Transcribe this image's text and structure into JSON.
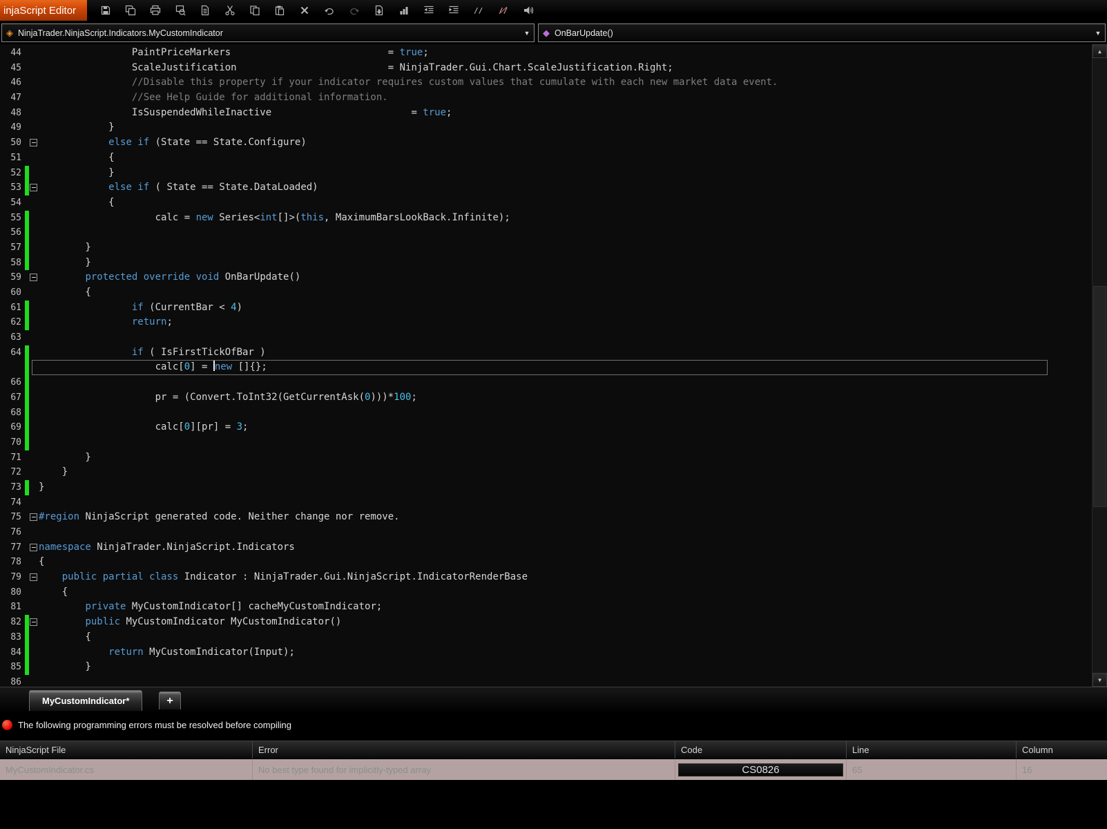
{
  "window": {
    "title": "injaScript Editor"
  },
  "colors": {
    "kw": "#569cd6",
    "cm": "#7e7e7e",
    "num": "#48c0e8",
    "txt": "#d6d6d6",
    "chg": "#1ddd1d",
    "titleTop": "#e8661c",
    "titleBot": "#9d3304",
    "rowBg": "#b4a2a2",
    "red": "#d80b00"
  },
  "toolbar": {
    "icons": [
      "save-icon",
      "save-all-icon",
      "print-icon",
      "print-preview-icon",
      "document-icon",
      "scissors-icon",
      "copy-icon",
      "paste-icon",
      "delete-x-icon",
      "undo-arrow-icon",
      "redo-arrow-icon",
      "snippet-icon",
      "chart-bars-icon",
      "outdent-icon",
      "indent-icon",
      "comment-icon",
      "uncomment-icon",
      "compile-speaker-icon"
    ]
  },
  "navigation": {
    "type_selector": "NinjaTrader.NinjaScript.Indicators.MyCustomIndicator",
    "member_selector": "OnBarUpdate()"
  },
  "tabs": {
    "active": "MyCustomIndicator*",
    "new_tab": "+"
  },
  "editor": {
    "lines": [
      {
        "n": "44",
        "seg": [
          [
            "                PaintPriceMarkers                           = ",
            "d"
          ],
          [
            "true",
            "k"
          ],
          [
            ";",
            "d"
          ]
        ]
      },
      {
        "n": "45",
        "seg": [
          [
            "                ScaleJustification                          = NinjaTrader.Gui.Chart.ScaleJustification.Right;",
            "d"
          ]
        ]
      },
      {
        "n": "46",
        "seg": [
          [
            "                //Disable this property if your indicator requires custom values that cumulate with each new market data event.",
            "c"
          ]
        ]
      },
      {
        "n": "47",
        "seg": [
          [
            "                //See Help Guide for additional information.",
            "c"
          ]
        ]
      },
      {
        "n": "48",
        "seg": [
          [
            "                IsSuspendedWhileInactive                        = ",
            "d"
          ],
          [
            "true",
            "k"
          ],
          [
            ";",
            "d"
          ]
        ]
      },
      {
        "n": "49",
        "seg": [
          [
            "            }",
            "d"
          ]
        ]
      },
      {
        "n": "50",
        "fold": true,
        "seg": [
          [
            "            ",
            "d"
          ],
          [
            "else if",
            "k"
          ],
          [
            " (State == State.Configure)",
            "d"
          ]
        ]
      },
      {
        "n": "51",
        "seg": [
          [
            "            {",
            "d"
          ]
        ]
      },
      {
        "n": "52",
        "green": true,
        "seg": [
          [
            "            }",
            "d"
          ]
        ]
      },
      {
        "n": "53",
        "fold": true,
        "green": true,
        "seg": [
          [
            "            ",
            "d"
          ],
          [
            "else if",
            "k"
          ],
          [
            " ( State == State.DataLoaded)",
            "d"
          ]
        ]
      },
      {
        "n": "54",
        "seg": [
          [
            "            {",
            "d"
          ]
        ]
      },
      {
        "n": "55",
        "green": true,
        "seg": [
          [
            "                    calc = ",
            "d"
          ],
          [
            "new",
            "k"
          ],
          [
            " Series<",
            "d"
          ],
          [
            "int",
            "k"
          ],
          [
            "[]>(",
            "d"
          ],
          [
            "this",
            "k"
          ],
          [
            ", MaximumBarsLookBack.Infinite);",
            "d"
          ]
        ]
      },
      {
        "n": "56",
        "green": true,
        "seg": []
      },
      {
        "n": "57",
        "green": true,
        "seg": [
          [
            "        }",
            "d"
          ]
        ]
      },
      {
        "n": "58",
        "green": true,
        "seg": [
          [
            "        }",
            "d"
          ]
        ]
      },
      {
        "n": "59",
        "fold": true,
        "seg": [
          [
            "        ",
            "d"
          ],
          [
            "protected override void",
            "k"
          ],
          [
            " OnBarUpdate()",
            "d"
          ]
        ]
      },
      {
        "n": "60",
        "seg": [
          [
            "        {",
            "d"
          ]
        ]
      },
      {
        "n": "61",
        "green": true,
        "seg": [
          [
            "                ",
            "d"
          ],
          [
            "if",
            "k"
          ],
          [
            " (CurrentBar < ",
            "d"
          ],
          [
            "4",
            "n"
          ],
          [
            ")",
            "d"
          ]
        ]
      },
      {
        "n": "62",
        "green": true,
        "seg": [
          [
            "                ",
            "d"
          ],
          [
            "return",
            "k"
          ],
          [
            ";",
            "d"
          ]
        ]
      },
      {
        "n": "63",
        "seg": []
      },
      {
        "n": "64",
        "green": true,
        "seg": [
          [
            "                ",
            "d"
          ],
          [
            "if",
            "k"
          ],
          [
            " ( IsFirstTickOfBar )",
            "d"
          ]
        ]
      },
      {
        "n": "",
        "sel": true,
        "green": true,
        "seg": [
          [
            "                    calc[",
            "d"
          ],
          [
            "0",
            "n"
          ],
          [
            "] = ",
            "d"
          ],
          [
            "",
            "caret"
          ],
          [
            "new",
            "k"
          ],
          [
            " []{};",
            "d"
          ]
        ]
      },
      {
        "n": "66",
        "green": true,
        "seg": []
      },
      {
        "n": "67",
        "green": true,
        "seg": [
          [
            "                    pr = (Convert.ToInt32(GetCurrentAsk(",
            "d"
          ],
          [
            "0",
            "n"
          ],
          [
            ")))*",
            "d"
          ],
          [
            "100",
            "n"
          ],
          [
            ";",
            "d"
          ]
        ]
      },
      {
        "n": "68",
        "green": true,
        "seg": []
      },
      {
        "n": "69",
        "green": true,
        "seg": [
          [
            "                    calc[",
            "d"
          ],
          [
            "0",
            "n"
          ],
          [
            "][pr] = ",
            "d"
          ],
          [
            "3",
            "n"
          ],
          [
            ";",
            "d"
          ]
        ]
      },
      {
        "n": "70",
        "green": true,
        "seg": []
      },
      {
        "n": "71",
        "seg": [
          [
            "        }",
            "d"
          ]
        ]
      },
      {
        "n": "72",
        "seg": [
          [
            "    }",
            "d"
          ]
        ]
      },
      {
        "n": "73",
        "green": true,
        "seg": [
          [
            "}",
            "d"
          ]
        ]
      },
      {
        "n": "74",
        "seg": []
      },
      {
        "n": "75",
        "fold": true,
        "seg": [
          [
            "#region",
            "k"
          ],
          [
            " NinjaScript generated code. Neither change nor remove.",
            "d"
          ]
        ]
      },
      {
        "n": "76",
        "seg": []
      },
      {
        "n": "77",
        "fold": true,
        "seg": [
          [
            "namespace",
            "k"
          ],
          [
            " NinjaTrader.NinjaScript.Indicators",
            "d"
          ]
        ]
      },
      {
        "n": "78",
        "seg": [
          [
            "{",
            "d"
          ]
        ]
      },
      {
        "n": "79",
        "fold": true,
        "seg": [
          [
            "    ",
            "d"
          ],
          [
            "public partial class",
            "k"
          ],
          [
            " Indicator : NinjaTrader.Gui.NinjaScript.IndicatorRenderBase",
            "d"
          ]
        ]
      },
      {
        "n": "80",
        "seg": [
          [
            "    {",
            "d"
          ]
        ]
      },
      {
        "n": "81",
        "seg": [
          [
            "        ",
            "d"
          ],
          [
            "private",
            "k"
          ],
          [
            " MyCustomIndicator[] cacheMyCustomIndicator;",
            "d"
          ]
        ]
      },
      {
        "n": "82",
        "fold": true,
        "green": true,
        "seg": [
          [
            "        ",
            "d"
          ],
          [
            "public",
            "k"
          ],
          [
            " MyCustomIndicator MyCustomIndicator()",
            "d"
          ]
        ]
      },
      {
        "n": "83",
        "green": true,
        "seg": [
          [
            "        {",
            "d"
          ]
        ]
      },
      {
        "n": "84",
        "green": true,
        "seg": [
          [
            "            ",
            "d"
          ],
          [
            "return",
            "k"
          ],
          [
            " MyCustomIndicator(Input);",
            "d"
          ]
        ]
      },
      {
        "n": "85",
        "green": true,
        "seg": [
          [
            "        }",
            "d"
          ]
        ]
      },
      {
        "n": "86",
        "seg": []
      }
    ]
  },
  "errors": {
    "banner": "The following programming errors must be resolved before compiling",
    "columns": [
      "NinjaScript File",
      "Error",
      "Code",
      "Line",
      "Column"
    ],
    "rows": [
      {
        "file": "MyCustomIndicator.cs",
        "error": "No best type found for implicitly-typed array",
        "code": "CS0826",
        "line": "65",
        "column": "16"
      }
    ]
  }
}
